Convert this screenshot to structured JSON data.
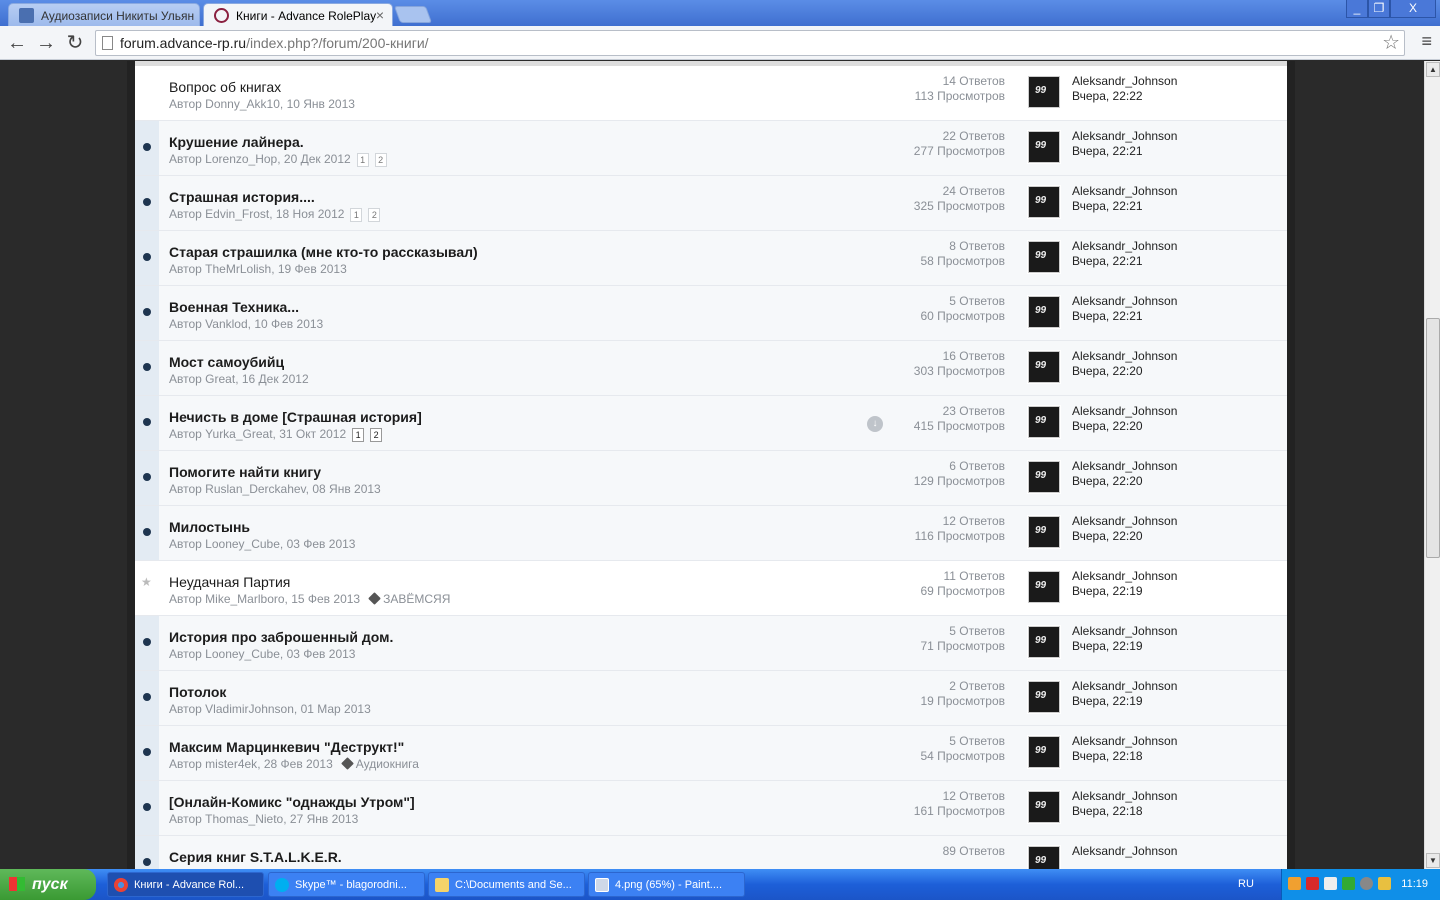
{
  "browser": {
    "tabs": [
      {
        "label": "Аудиозаписи Никиты Ульян",
        "active": false
      },
      {
        "label": "Книги - Advance RolePlay",
        "active": true
      }
    ],
    "url_domain": "forum.advance-rp.ru",
    "url_path": "/index.php?/forum/200-книги/",
    "window_buttons": [
      "_",
      "❐",
      "X"
    ]
  },
  "topics": [
    {
      "title": "Вопрос об книгах",
      "bold": false,
      "author": "Donny_Akk10",
      "date": "10 Янв 2013",
      "replies": "14 Ответов",
      "views": "113 Просмотров",
      "last_user": "Aleksandr_Johnson",
      "last_time": "Вчера, 22:22",
      "pages": [],
      "tag": "",
      "icon": "none"
    },
    {
      "title": "Крушение лайнера.",
      "bold": true,
      "author": "Lorenzo_Hop",
      "date": "20 Дек 2012",
      "replies": "22 Ответов",
      "views": "277 Просмотров",
      "last_user": "Aleksandr_Johnson",
      "last_time": "Вчера, 22:21",
      "pages": [
        "1",
        "2"
      ],
      "tag": "",
      "icon": "dot"
    },
    {
      "title": "Страшная история....",
      "bold": true,
      "author": "Edvin_Frost",
      "date": "18 Ноя 2012",
      "replies": "24 Ответов",
      "views": "325 Просмотров",
      "last_user": "Aleksandr_Johnson",
      "last_time": "Вчера, 22:21",
      "pages": [
        "1",
        "2"
      ],
      "tag": "",
      "icon": "dot"
    },
    {
      "title": "Старая страшилка (мне кто-то рассказывал)",
      "bold": true,
      "author": "TheMrLolish",
      "date": "19 Фев 2013",
      "replies": "8 Ответов",
      "views": "58 Просмотров",
      "last_user": "Aleksandr_Johnson",
      "last_time": "Вчера, 22:21",
      "pages": [],
      "tag": "",
      "icon": "dot"
    },
    {
      "title": "Военная Техника...",
      "bold": true,
      "author": "Vanklod",
      "date": "10 Фев 2013",
      "replies": "5 Ответов",
      "views": "60 Просмотров",
      "last_user": "Aleksandr_Johnson",
      "last_time": "Вчера, 22:21",
      "pages": [],
      "tag": "",
      "icon": "dot"
    },
    {
      "title": "Мост самоубийц",
      "bold": true,
      "author": "Great",
      "date": "16 Дек 2012",
      "replies": "16 Ответов",
      "views": "303 Просмотров",
      "last_user": "Aleksandr_Johnson",
      "last_time": "Вчера, 22:20",
      "pages": [],
      "tag": "",
      "icon": "dot"
    },
    {
      "title": "Нечисть в доме [Страшная история]",
      "bold": true,
      "author": "Yurka_Great",
      "date": "31 Окт 2012",
      "replies": "23 Ответов",
      "views": "415 Просмотров",
      "last_user": "Aleksandr_Johnson",
      "last_time": "Вчера, 22:20",
      "pages": [
        "1",
        "2"
      ],
      "pages_dark": true,
      "tag": "",
      "icon": "dot",
      "download": true
    },
    {
      "title": "Помогите найти книгу",
      "bold": true,
      "author": "Ruslan_Derckahev",
      "date": "08 Янв 2013",
      "replies": "6 Ответов",
      "views": "129 Просмотров",
      "last_user": "Aleksandr_Johnson",
      "last_time": "Вчера, 22:20",
      "pages": [],
      "tag": "",
      "icon": "dot"
    },
    {
      "title": "Милостынь",
      "bold": true,
      "author": "Looney_Cube",
      "date": "03 Фев 2013",
      "replies": "12 Ответов",
      "views": "116 Просмотров",
      "last_user": "Aleksandr_Johnson",
      "last_time": "Вчера, 22:20",
      "pages": [],
      "tag": "",
      "icon": "dot"
    },
    {
      "title": "Неудачная Партия",
      "bold": false,
      "author": "Mike_Marlboro",
      "date": "15 Фев 2013",
      "replies": "11 Ответов",
      "views": "69 Просмотров",
      "last_user": "Aleksandr_Johnson",
      "last_time": "Вчера, 22:19",
      "pages": [],
      "tag": "ЗАВЁМСЯЯ",
      "icon": "star"
    },
    {
      "title": "История про заброшенный дом.",
      "bold": true,
      "author": "Looney_Cube",
      "date": "03 Фев 2013",
      "replies": "5 Ответов",
      "views": "71 Просмотров",
      "last_user": "Aleksandr_Johnson",
      "last_time": "Вчера, 22:19",
      "pages": [],
      "tag": "",
      "icon": "dot"
    },
    {
      "title": "Потолок",
      "bold": true,
      "author": "VladimirJohnson",
      "date": "01 Мар 2013",
      "replies": "2 Ответов",
      "views": "19 Просмотров",
      "last_user": "Aleksandr_Johnson",
      "last_time": "Вчера, 22:19",
      "pages": [],
      "tag": "",
      "icon": "dot"
    },
    {
      "title": "Максим Марцинкевич \"Деструкт!\"",
      "bold": true,
      "author": "mister4ek",
      "date": "28 Фев 2013",
      "replies": "5 Ответов",
      "views": "54 Просмотров",
      "last_user": "Aleksandr_Johnson",
      "last_time": "Вчера, 22:18",
      "pages": [],
      "tag": "Аудиокнига",
      "icon": "dot"
    },
    {
      "title": "[Онлайн-Комикс \"однажды Утром\"]",
      "bold": true,
      "author": "Thomas_Nieto",
      "date": "27 Янв 2013",
      "replies": "12 Ответов",
      "views": "161 Просмотров",
      "last_user": "Aleksandr_Johnson",
      "last_time": "Вчера, 22:18",
      "pages": [],
      "tag": "",
      "icon": "dot"
    },
    {
      "title": "Серия книг S.T.A.L.K.E.R.",
      "bold": true,
      "author": "",
      "date": "",
      "replies": "89 Ответов",
      "views": "",
      "last_user": "Aleksandr_Johnson",
      "last_time": "",
      "pages": [],
      "tag": "",
      "icon": "dot"
    }
  ],
  "author_prefix": "Автор",
  "taskbar": {
    "start_label": "пуск",
    "tasks": [
      {
        "label": "Книги - Advance Rol...",
        "active": true
      },
      {
        "label": "Skype™ - blagorodni...",
        "active": false
      },
      {
        "label": "C:\\Documents and Se...",
        "active": false
      },
      {
        "label": "4.png (65%) - Paint....",
        "active": false
      }
    ],
    "lang": "RU",
    "clock": "11:19"
  },
  "colors": {
    "accent": "#1e3550",
    "taskbar": "#245edb",
    "start": "#3a9a33"
  }
}
